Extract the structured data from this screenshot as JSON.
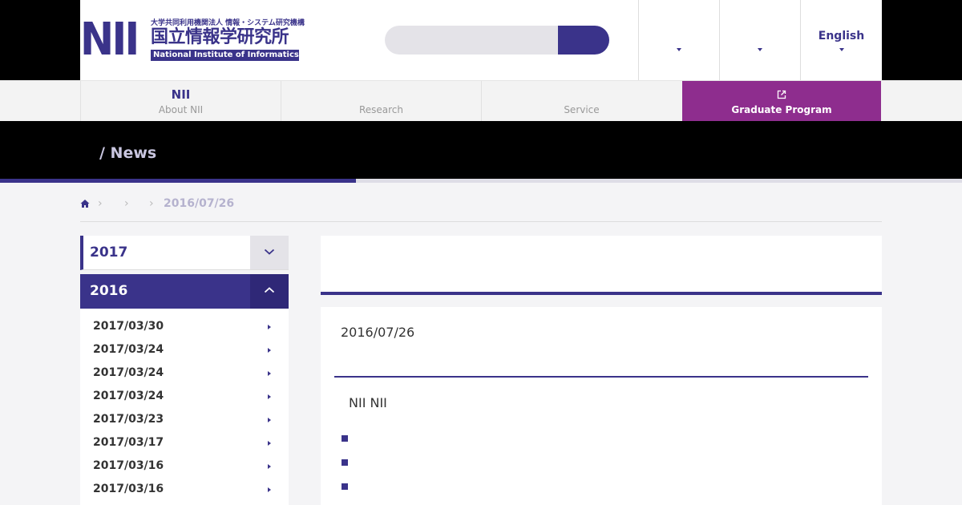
{
  "header": {
    "logo": {
      "mark": "NII",
      "jp_small": "大学共同利用機関法人 情報・システム研究機構",
      "jp_name": "国立情報学研究所",
      "en_name": "National Institute of Informatics"
    },
    "search": {
      "placeholder": "",
      "value": ""
    },
    "menus": [
      {
        "label": ""
      },
      {
        "label": ""
      },
      {
        "label": "English"
      }
    ]
  },
  "global_nav": [
    {
      "title": "NII",
      "subtitle": "About NII"
    },
    {
      "title": "",
      "subtitle": "Research"
    },
    {
      "title": "",
      "subtitle": "Service"
    },
    {
      "title": "",
      "subtitle": "Graduate Program",
      "external": true
    }
  ],
  "page": {
    "title": "/ News"
  },
  "breadcrumb": {
    "current": "2016/07/26"
  },
  "sidebar": {
    "years": [
      {
        "label": "2017",
        "expanded": false
      },
      {
        "label": "2016",
        "expanded": true
      }
    ],
    "items": [
      {
        "date": "2017/03/30"
      },
      {
        "date": "2017/03/24"
      },
      {
        "date": "2017/03/24"
      },
      {
        "date": "2017/03/24"
      },
      {
        "date": "2017/03/23"
      },
      {
        "date": "2017/03/17"
      },
      {
        "date": "2017/03/16"
      },
      {
        "date": "2017/03/16"
      }
    ]
  },
  "article": {
    "date": "2016/07/26",
    "body": "NII NII",
    "bullets": [
      "",
      "",
      ""
    ]
  },
  "colors": {
    "brand": "#3a338a",
    "graduate": "#8e2d8e",
    "black": "#000000"
  }
}
